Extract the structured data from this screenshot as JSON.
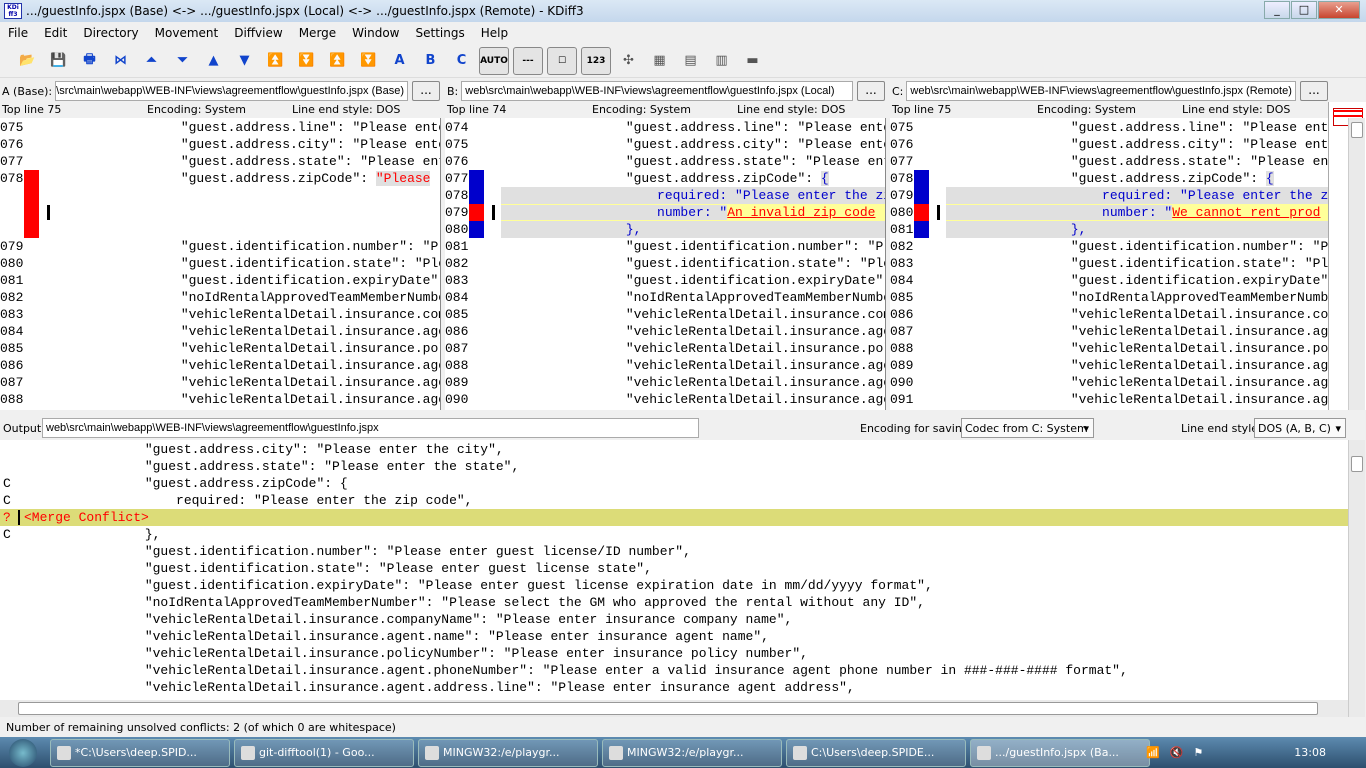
{
  "title": ".../guestInfo.jspx (Base) <-> .../guestInfo.jspx (Local) <-> .../guestInfo.jspx (Remote) - KDiff3",
  "logo_text": "KDiff3",
  "menu": [
    "File",
    "Edit",
    "Directory",
    "Movement",
    "Diffview",
    "Merge",
    "Window",
    "Settings",
    "Help"
  ],
  "toolbar": [
    {
      "icon": "open-folder-icon",
      "g": "📂"
    },
    {
      "icon": "save-icon",
      "g": "💾"
    },
    {
      "icon": "print-icon",
      "g": "🖶"
    },
    {
      "icon": "current-delta-icon",
      "g": "⋈"
    },
    {
      "icon": "first-delta-icon",
      "g": "⏶"
    },
    {
      "icon": "last-delta-icon",
      "g": "⏷"
    },
    {
      "icon": "prev-delta-icon",
      "g": "▲"
    },
    {
      "icon": "next-delta-icon",
      "g": "▼"
    },
    {
      "icon": "prev-conflict-icon",
      "g": "⏫"
    },
    {
      "icon": "next-conflict-icon",
      "g": "⏬"
    },
    {
      "icon": "prev-unsolved-icon",
      "g": "⏫"
    },
    {
      "icon": "next-unsolved-icon",
      "g": "⏬"
    },
    {
      "icon": "select-a-icon",
      "g": "A"
    },
    {
      "icon": "select-b-icon",
      "g": "B"
    },
    {
      "icon": "select-c-icon",
      "g": "C"
    }
  ],
  "toolbar_toggles": [
    {
      "icon": "auto-advance-icon",
      "g": "AUTO"
    },
    {
      "icon": "show-whitespace-icon",
      "g": "---"
    },
    {
      "icon": "show-white-space-chars-icon",
      "g": "☐"
    },
    {
      "icon": "line-numbers-icon",
      "g": "123"
    }
  ],
  "toolbar_extra": [
    {
      "icon": "sync-icon",
      "g": "✣"
    },
    {
      "icon": "split-icon",
      "g": "▦"
    },
    {
      "icon": "overview-icon",
      "g": "▤"
    },
    {
      "icon": "word-wrap-icon",
      "g": "▥"
    },
    {
      "icon": "minus-icon",
      "g": "▬"
    }
  ],
  "panes": [
    {
      "label": "A (Base):",
      "path": "web\\src\\main\\webapp\\WEB-INF\\views\\agreementflow\\guestInfo.jspx (Base)",
      "top_line": "Top line 75",
      "encoding": "Encoding: System",
      "line_end": "Line end style: DOS",
      "rows": [
        {
          "n": "075",
          "t": "                \"guest.address.line\": \"Please enter the"
        },
        {
          "n": "076",
          "t": "                \"guest.address.city\": \"Please enter the"
        },
        {
          "n": "077",
          "t": "                \"guest.address.state\": \"Please enter the"
        },
        {
          "n": "078",
          "t": "                \"guest.address.zipCode\": ",
          "hl": "\"Please",
          "m": "red"
        },
        {
          "n": "",
          "t": "",
          "m": "red"
        },
        {
          "n": "",
          "t": "",
          "m": "red",
          "bg": "yellowdark",
          "cur": true
        },
        {
          "n": "",
          "t": "",
          "m": "red"
        },
        {
          "n": "079",
          "t": "                \"guest.identification.number\": \"Please"
        },
        {
          "n": "080",
          "t": "                \"guest.identification.state\": \"Please"
        },
        {
          "n": "081",
          "t": "                \"guest.identification.expiryDate\": \"P"
        },
        {
          "n": "082",
          "t": "                \"noIdRentalApprovedTeamMemberNumber\":"
        },
        {
          "n": "083",
          "t": "                \"vehicleRentalDetail.insurance.company"
        },
        {
          "n": "084",
          "t": "                \"vehicleRentalDetail.insurance.agent.n"
        },
        {
          "n": "085",
          "t": "                \"vehicleRentalDetail.insurance.policyN"
        },
        {
          "n": "086",
          "t": "                \"vehicleRentalDetail.insurance.agent.p"
        },
        {
          "n": "087",
          "t": "                \"vehicleRentalDetail.insurance.agent.a"
        },
        {
          "n": "088",
          "t": "                \"vehicleRentalDetail.insurance.agent.a"
        }
      ]
    },
    {
      "label": "B:",
      "path": "web\\src\\main\\webapp\\WEB-INF\\views\\agreementflow\\guestInfo.jspx (Local)",
      "top_line": "Top line 74",
      "encoding": "Encoding: System",
      "line_end": "Line end style: DOS",
      "rows": [
        {
          "n": "074",
          "t": "                \"guest.address.line\": \"Please enter the"
        },
        {
          "n": "075",
          "t": "                \"guest.address.city\": \"Please enter the"
        },
        {
          "n": "076",
          "t": "                \"guest.address.state\": \"Please enter the"
        },
        {
          "n": "077",
          "t": "                \"guest.address.zipCode\": ",
          "blue": "{",
          "m": "blue"
        },
        {
          "n": "078",
          "t": "",
          "blue": "                    required: \"Please enter the zip code\",",
          "m": "blue",
          "bg": "gray"
        },
        {
          "n": "079",
          "t": "",
          "blue": "                    number: \"",
          "red": "An_invalid_zip_code",
          "m": "red",
          "bg": "yellow",
          "cur": true
        },
        {
          "n": "080",
          "t": "",
          "blue": "                },",
          "m": "blue",
          "bg": "gray"
        },
        {
          "n": "081",
          "t": "                \"guest.identification.number\": \"Please"
        },
        {
          "n": "082",
          "t": "                \"guest.identification.state\": \"Please"
        },
        {
          "n": "083",
          "t": "                \"guest.identification.expiryDate\": \"P"
        },
        {
          "n": "084",
          "t": "                \"noIdRentalApprovedTeamMemberNumber\":"
        },
        {
          "n": "085",
          "t": "                \"vehicleRentalDetail.insurance.company"
        },
        {
          "n": "086",
          "t": "                \"vehicleRentalDetail.insurance.agent.n"
        },
        {
          "n": "087",
          "t": "                \"vehicleRentalDetail.insurance.policyN"
        },
        {
          "n": "088",
          "t": "                \"vehicleRentalDetail.insurance.agent.p"
        },
        {
          "n": "089",
          "t": "                \"vehicleRentalDetail.insurance.agent.a"
        },
        {
          "n": "090",
          "t": "                \"vehicleRentalDetail.insurance.agent.a"
        }
      ]
    },
    {
      "label": "C:",
      "path": "web\\src\\main\\webapp\\WEB-INF\\views\\agreementflow\\guestInfo.jspx (Remote)",
      "top_line": "Top line 75",
      "encoding": "Encoding: System",
      "line_end": "Line end style: DOS",
      "rows": [
        {
          "n": "075",
          "t": "                \"guest.address.line\": \"Please enter the"
        },
        {
          "n": "076",
          "t": "                \"guest.address.city\": \"Please enter the"
        },
        {
          "n": "077",
          "t": "                \"guest.address.state\": \"Please enter the"
        },
        {
          "n": "078",
          "t": "                \"guest.address.zipCode\": ",
          "blue": "{",
          "m": "blue"
        },
        {
          "n": "079",
          "t": "",
          "blue": "                    required: \"Please enter the zip code\",",
          "m": "blue",
          "bg": "gray"
        },
        {
          "n": "080",
          "t": "",
          "blue": "                    number: \"",
          "red": "We_cannot_rent_prod",
          "m": "red",
          "bg": "yellow",
          "cur": true
        },
        {
          "n": "081",
          "t": "",
          "blue": "                },",
          "m": "blue",
          "bg": "gray"
        },
        {
          "n": "082",
          "t": "                \"guest.identification.number\": \"Please"
        },
        {
          "n": "083",
          "t": "                \"guest.identification.state\": \"Please"
        },
        {
          "n": "084",
          "t": "                \"guest.identification.expiryDate\": \"P"
        },
        {
          "n": "085",
          "t": "                \"noIdRentalApprovedTeamMemberNumber\":"
        },
        {
          "n": "086",
          "t": "                \"vehicleRentalDetail.insurance.company"
        },
        {
          "n": "087",
          "t": "                \"vehicleRentalDetail.insurance.agent.n"
        },
        {
          "n": "088",
          "t": "                \"vehicleRentalDetail.insurance.policyN"
        },
        {
          "n": "089",
          "t": "                \"vehicleRentalDetail.insurance.agent.p"
        },
        {
          "n": "090",
          "t": "                \"vehicleRentalDetail.insurance.agent.a"
        },
        {
          "n": "091",
          "t": "                \"vehicleRentalDetail.insurance.agent.a"
        }
      ]
    }
  ],
  "output": {
    "label": "Output:",
    "path": "web\\src\\main\\webapp\\WEB-INF\\views\\agreementflow\\guestInfo.jspx",
    "encoding_label": "Encoding for saving:",
    "encoding_value": "Codec from C: System",
    "line_end_label": "Line end style:",
    "line_end_value": "DOS (A, B, C)",
    "rows": [
      {
        "s": "",
        "t": "                \"guest.address.city\": \"Please enter the city\","
      },
      {
        "s": "",
        "t": "                \"guest.address.state\": \"Please enter the state\","
      },
      {
        "s": "C",
        "t": "                \"guest.address.zipCode\": {"
      },
      {
        "s": "C",
        "t": "                    required: \"Please enter the zip code\","
      },
      {
        "s": "?",
        "t": "<Merge Conflict>",
        "conflict": true
      },
      {
        "s": "C",
        "t": "                },"
      },
      {
        "s": "",
        "t": "                \"guest.identification.number\": \"Please enter guest license/ID number\","
      },
      {
        "s": "",
        "t": "                \"guest.identification.state\": \"Please enter guest license state\","
      },
      {
        "s": "",
        "t": "                \"guest.identification.expiryDate\": \"Please enter guest license expiration date in mm/dd/yyyy format\","
      },
      {
        "s": "",
        "t": "                \"noIdRentalApprovedTeamMemberNumber\": \"Please select the GM who approved the rental without any ID\","
      },
      {
        "s": "",
        "t": "                \"vehicleRentalDetail.insurance.companyName\": \"Please enter insurance company name\","
      },
      {
        "s": "",
        "t": "                \"vehicleRentalDetail.insurance.agent.name\": \"Please enter insurance agent name\","
      },
      {
        "s": "",
        "t": "                \"vehicleRentalDetail.insurance.policyNumber\": \"Please enter insurance policy number\","
      },
      {
        "s": "",
        "t": "                \"vehicleRentalDetail.insurance.agent.phoneNumber\": \"Please enter a valid insurance agent phone number in ###-###-#### format\","
      },
      {
        "s": "",
        "t": "                \"vehicleRentalDetail.insurance.agent.address.line\": \"Please enter insurance agent address\","
      }
    ]
  },
  "status": "Number of remaining unsolved conflicts: 2 (of which 0 are whitespace)",
  "taskbar": {
    "items": [
      "*C:\\Users\\deep.SPID...",
      "git-difftool(1) - Goo...",
      "MINGW32:/e/playgr...",
      "MINGW32:/e/playgr...",
      "C:\\Users\\deep.SPIDE...",
      ".../guestInfo.jspx (Ba..."
    ],
    "clock": "13:08"
  },
  "colors": {
    "conflict_red": "#ff0000",
    "diff_blue": "#0000cc",
    "yellow": "#ffff99",
    "yellow_dark": "#dcdc78",
    "gray": "#e0e0e0"
  }
}
